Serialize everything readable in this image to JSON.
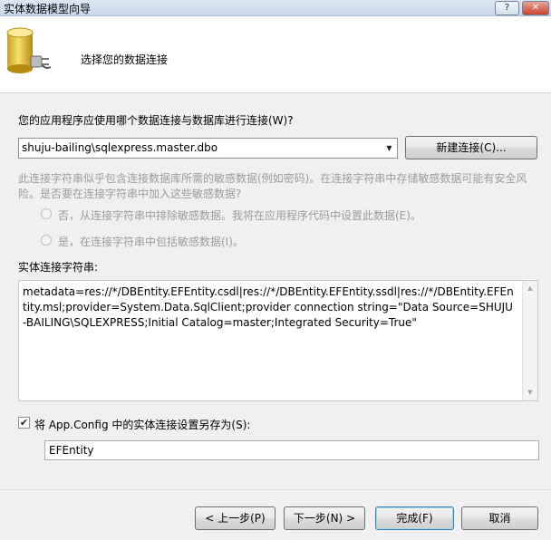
{
  "window": {
    "title": "实体数据模型向导",
    "help_label": "?",
    "close_label": "✕"
  },
  "header": {
    "title": "选择您的数据连接"
  },
  "connection": {
    "question": "您的应用程序应使用哪个数据连接与数据库进行连接(W)?",
    "selected": "shuju-bailing\\sqlexpress.master.dbo",
    "new_button": "新建连接(C)..."
  },
  "sensitive": {
    "warning_line1": "此连接字符串似乎包含连接数据库所需的敏感数据(例如密码)。在连接字符串中存储敏感数据可能有安全风",
    "warning_line2": "险。是否要在连接字符串中加入这些敏感数据?",
    "option_exclude": "否，从连接字符串中排除敏感数据。我将在应用程序代码中设置此数据(E)。",
    "option_include": "是，在连接字符串中包括敏感数据(I)。"
  },
  "entity_connection": {
    "label": "实体连接字符串:",
    "value": "metadata=res://*/DBEntity.EFEntity.csdl|res://*/DBEntity.EFEntity.ssdl|res://*/DBEntity.EFEntity.msl;provider=System.Data.SqlClient;provider connection string=\"Data Source=SHUJU-BAILING\\SQLEXPRESS;Initial Catalog=master;Integrated Security=True\""
  },
  "save_config": {
    "checked": true,
    "label": "将 App.Config 中的实体连接设置另存为(S):",
    "value": "EFEntity"
  },
  "footer": {
    "back": "< 上一步(P)",
    "next": "下一步(N) >",
    "finish": "完成(F)",
    "cancel": "取消"
  }
}
